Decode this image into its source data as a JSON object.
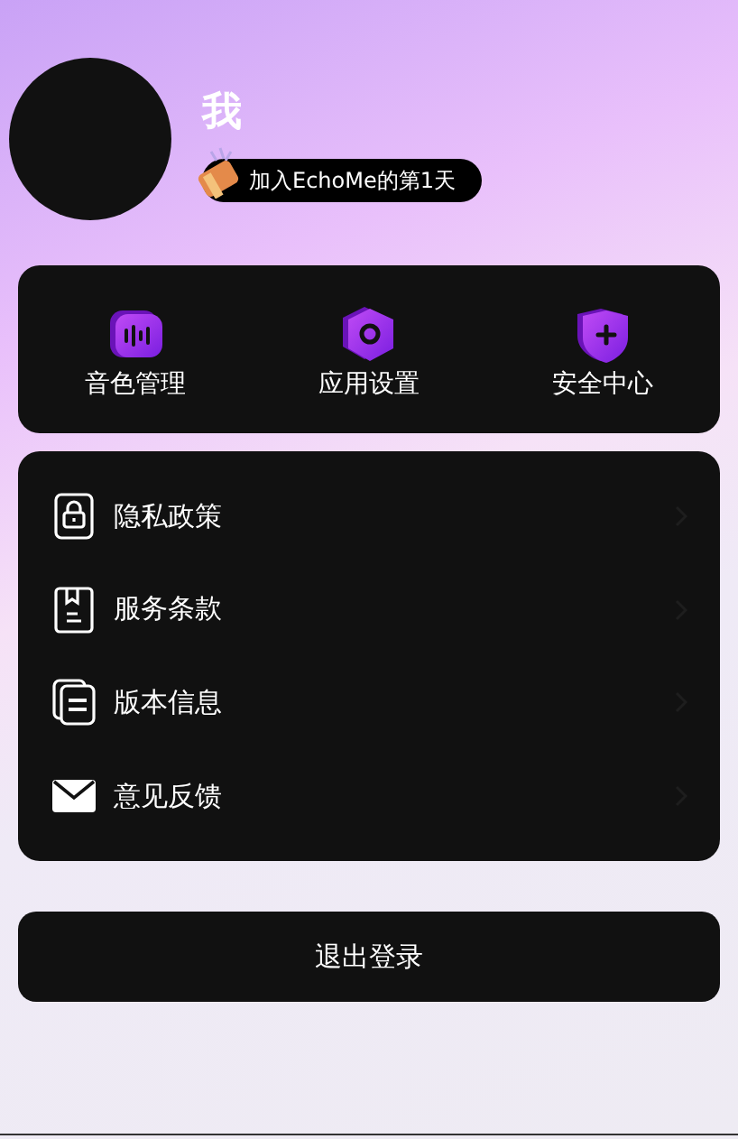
{
  "profile": {
    "name": "我",
    "badge": "加入EchoMe的第1天"
  },
  "quick_actions": [
    {
      "kind": "voice",
      "label": "音色管理"
    },
    {
      "kind": "settings",
      "label": "应用设置"
    },
    {
      "kind": "security",
      "label": "安全中心"
    }
  ],
  "menu": [
    {
      "kind": "lock",
      "label": "隐私政策"
    },
    {
      "kind": "book",
      "label": "服务条款"
    },
    {
      "kind": "docs",
      "label": "版本信息"
    },
    {
      "kind": "mail",
      "label": "意见反馈"
    }
  ],
  "logout_button": "退出登录"
}
